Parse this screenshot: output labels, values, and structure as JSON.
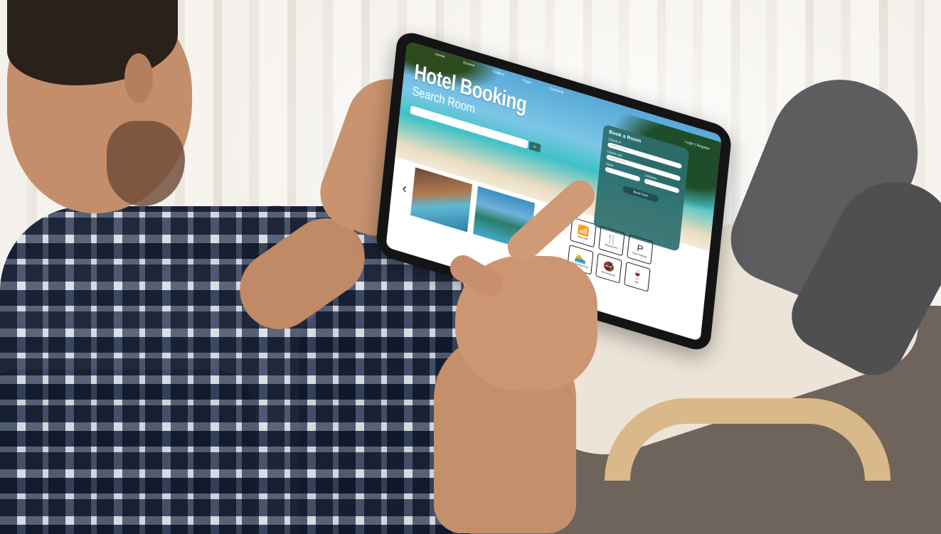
{
  "app": {
    "nav": [
      "Home",
      "Rooms",
      "Gallery",
      "Page",
      "Contacts"
    ],
    "auth_links": "Login  |  Register",
    "hero_title": "Hotel Booking",
    "hero_subtitle": "Search Room",
    "search_placeholder": "Type room type or check in date",
    "book_panel": {
      "title": "Book a Room",
      "check_in_label": "Check In",
      "check_in_placeholder": "Select the date",
      "check_out_label": "Check Out",
      "check_out_placeholder": "Select the date",
      "adult_label": "Adult",
      "adult_value": "1",
      "children_label": "Children",
      "children_value": "1",
      "button": "Book Now"
    },
    "amenities": [
      {
        "icon": "wifi-icon",
        "glyph": "📶",
        "label": "Free Wifi"
      },
      {
        "icon": "restaurant-icon",
        "glyph": "🍴",
        "label": "Restaurant"
      },
      {
        "icon": "parking-icon",
        "glyph": "P",
        "label": "Free Parking"
      },
      {
        "icon": "swimming-pool-icon",
        "glyph": "🏊",
        "label": "Swimming Pool"
      },
      {
        "icon": "no-smoking-icon",
        "glyph": "🚭",
        "label": "No Smoking"
      },
      {
        "icon": "bar-icon",
        "glyph": "🍷",
        "label": "Bar"
      }
    ]
  }
}
